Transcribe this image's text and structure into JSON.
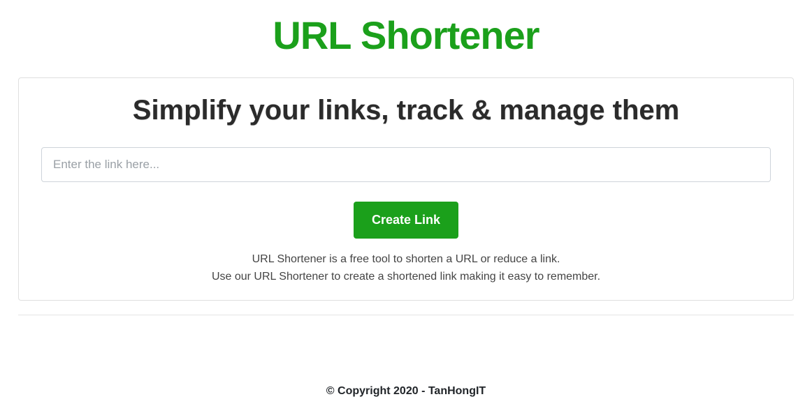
{
  "header": {
    "title": "URL Shortener"
  },
  "card": {
    "heading": "Simplify your links, track & manage them",
    "input_placeholder": "Enter the link here...",
    "button_label": "Create Link",
    "desc_line1": "URL Shortener is a free tool to shorten a URL or reduce a link.",
    "desc_line2": "Use our URL Shortener to create a shortened link making it easy to remember."
  },
  "footer": {
    "text": "© Copyright 2020 - TanHongIT"
  }
}
